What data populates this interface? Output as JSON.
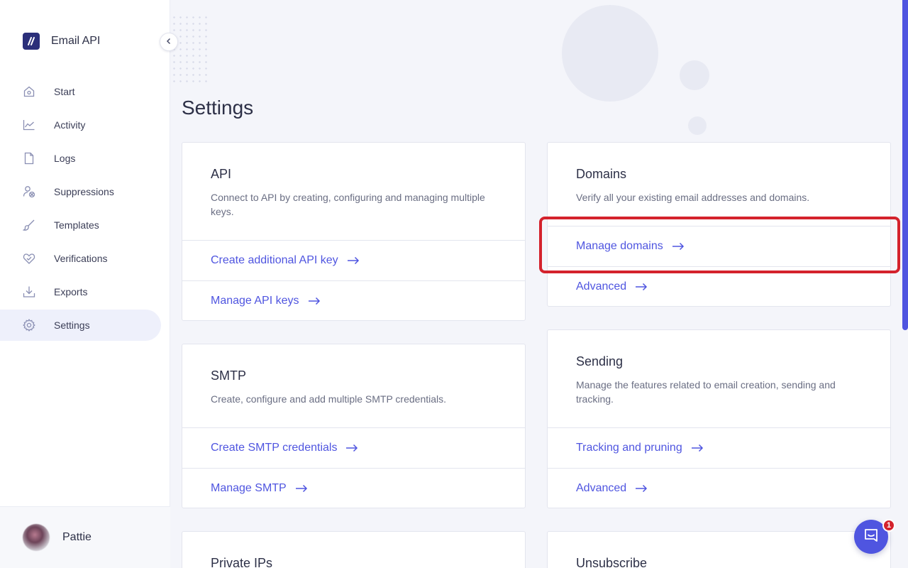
{
  "app": {
    "name": "Email API"
  },
  "sidebar": {
    "items": [
      {
        "label": "Start",
        "icon": "home-icon"
      },
      {
        "label": "Activity",
        "icon": "chart-line-icon"
      },
      {
        "label": "Logs",
        "icon": "file-icon"
      },
      {
        "label": "Suppressions",
        "icon": "user-blocked-icon"
      },
      {
        "label": "Templates",
        "icon": "brush-icon"
      },
      {
        "label": "Verifications",
        "icon": "heart-check-icon"
      },
      {
        "label": "Exports",
        "icon": "download-icon"
      },
      {
        "label": "Settings",
        "icon": "gear-icon",
        "active": true
      }
    ],
    "user": {
      "name": "Pattie"
    }
  },
  "page": {
    "title": "Settings"
  },
  "cards": {
    "api": {
      "title": "API",
      "description": "Connect to API by creating, configuring and managing multiple keys.",
      "links": [
        "Create additional API key",
        "Manage API keys"
      ]
    },
    "domains": {
      "title": "Domains",
      "description": "Verify all your existing email addresses and domains.",
      "links": [
        "Manage domains",
        "Advanced"
      ]
    },
    "smtp": {
      "title": "SMTP",
      "description": "Create, configure and add multiple SMTP credentials.",
      "links": [
        "Create SMTP credentials",
        "Manage SMTP"
      ]
    },
    "sending": {
      "title": "Sending",
      "description": "Manage the features related to email creation, sending and tracking.",
      "links": [
        "Tracking and pruning",
        "Advanced"
      ]
    },
    "private_ips": {
      "title": "Private IPs"
    },
    "unsubscribe": {
      "title": "Unsubscribe"
    }
  },
  "chat": {
    "badge_count": "1"
  },
  "colors": {
    "accent": "#4f55e0",
    "brand": "#2b2f7a",
    "highlight": "#d4222c"
  }
}
